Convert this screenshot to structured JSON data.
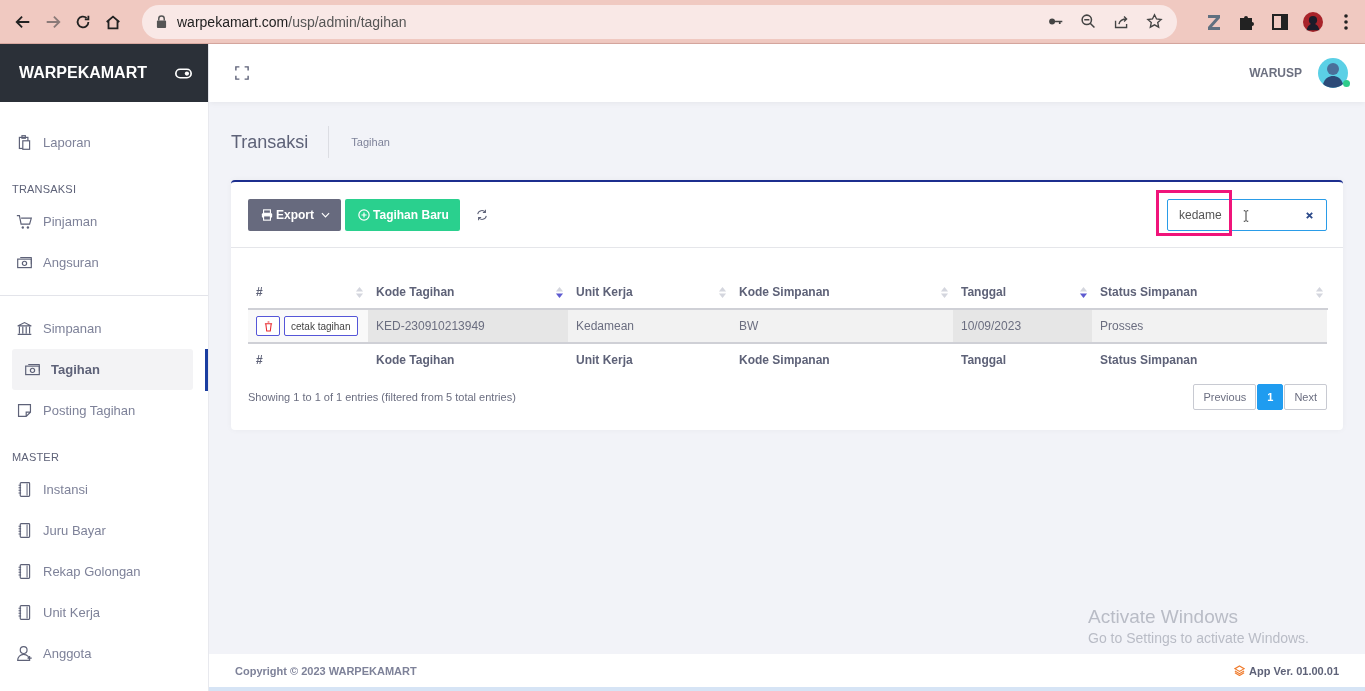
{
  "browser": {
    "url_host": "warpekamart.com",
    "url_path": "/usp/admin/tagihan",
    "forward": {
      "disabled": true
    }
  },
  "sidebar": {
    "brand": "WARPEKAMART",
    "sections": [
      {
        "items": [
          {
            "label": "Laporan",
            "selected": false
          }
        ]
      },
      {
        "heading": "TRANSAKSI",
        "items": [
          {
            "label": "Pinjaman",
            "selected": false
          },
          {
            "label": "Angsuran",
            "selected": false
          }
        ]
      },
      {
        "items": [
          {
            "label": "Simpanan",
            "selected": false
          },
          {
            "label": "Tagihan",
            "selected": true
          },
          {
            "label": "Posting Tagihan",
            "selected": false
          }
        ]
      },
      {
        "heading": "MASTER",
        "items": [
          {
            "label": "Instansi",
            "selected": false
          },
          {
            "label": "Juru Bayar",
            "selected": false
          },
          {
            "label": "Rekap Golongan",
            "selected": false
          },
          {
            "label": "Unit Kerja",
            "selected": false
          },
          {
            "label": "Anggota",
            "selected": false
          }
        ]
      }
    ]
  },
  "topbar": {
    "user": "WARUSP",
    "online": true
  },
  "page": {
    "title": "Transaksi",
    "breadcrumb": "Tagihan"
  },
  "toolbar": {
    "export": "Export",
    "new": "Tagihan Baru"
  },
  "search": {
    "value": "kedame",
    "highlighted": true
  },
  "table": {
    "columns": [
      {
        "label": "#",
        "sorted": false
      },
      {
        "label": "Kode Tagihan",
        "sorted": true
      },
      {
        "label": "Unit Kerja",
        "sorted": false
      },
      {
        "label": "Kode Simpanan",
        "sorted": false
      },
      {
        "label": "Tanggal",
        "sorted": true
      },
      {
        "label": "Status Simpanan",
        "sorted": false
      }
    ],
    "rows": [
      {
        "cells": [
          "cetak tagihan",
          "KED-230910213949",
          "Kedamean",
          "BW",
          "10/09/2023",
          "Prosses"
        ]
      }
    ],
    "footer_columns": [
      "#",
      "Kode Tagihan",
      "Unit Kerja",
      "Kode Simpanan",
      "Tanggal",
      "Status Simpanan"
    ]
  },
  "info": "Showing 1 to 1 of 1 entries (filtered from 5 total entries)",
  "pagination": {
    "previous": "Previous",
    "pages": [
      {
        "label": "1",
        "selected": true
      }
    ],
    "next": "Next"
  },
  "footer": {
    "copyright": "Copyright © 2023 WARPEKAMART",
    "version": "App Ver. 01.00.01"
  },
  "os_notice": {
    "title": "Activate Windows",
    "text": "Go to Settings to activate Windows."
  }
}
